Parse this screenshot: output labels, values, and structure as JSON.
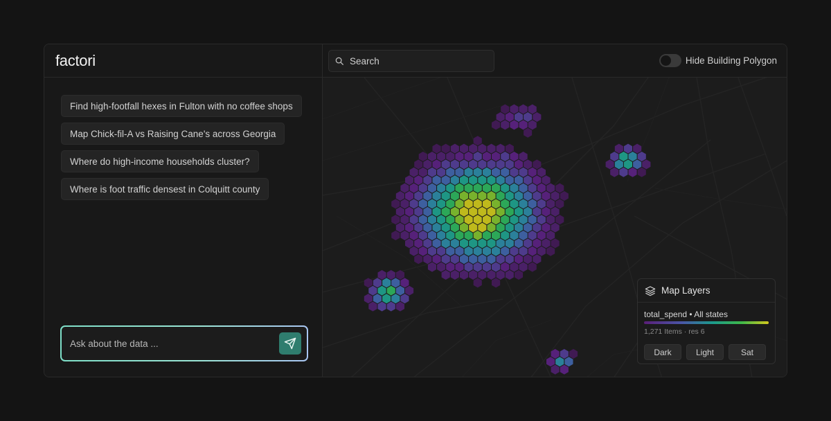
{
  "app": {
    "logo": "factori"
  },
  "suggestions": [
    "Find high-footfall hexes in Fulton with no coffee shops",
    "Map Chick-fil-A vs Raising Cane's across Georgia",
    "Where do high-income households cluster?",
    "Where is foot traffic densest in Colquitt county"
  ],
  "chat": {
    "placeholder": "Ask about the data ..."
  },
  "search": {
    "placeholder": "Search"
  },
  "toggle": {
    "label": "Hide Building Polygon",
    "on": false
  },
  "layers": {
    "title": "Map Layers",
    "layer_name": "total_spend • All states",
    "meta": "1,271 Items · res 6",
    "basemaps": [
      "Dark",
      "Light",
      "Sat"
    ],
    "ramp_colors": [
      "#5a1f78",
      "#4a55a6",
      "#1c9a8c",
      "#3db84a",
      "#d2c81e"
    ]
  },
  "icons": {
    "search": "search-icon",
    "send": "send-icon",
    "layers": "layers-icon"
  }
}
